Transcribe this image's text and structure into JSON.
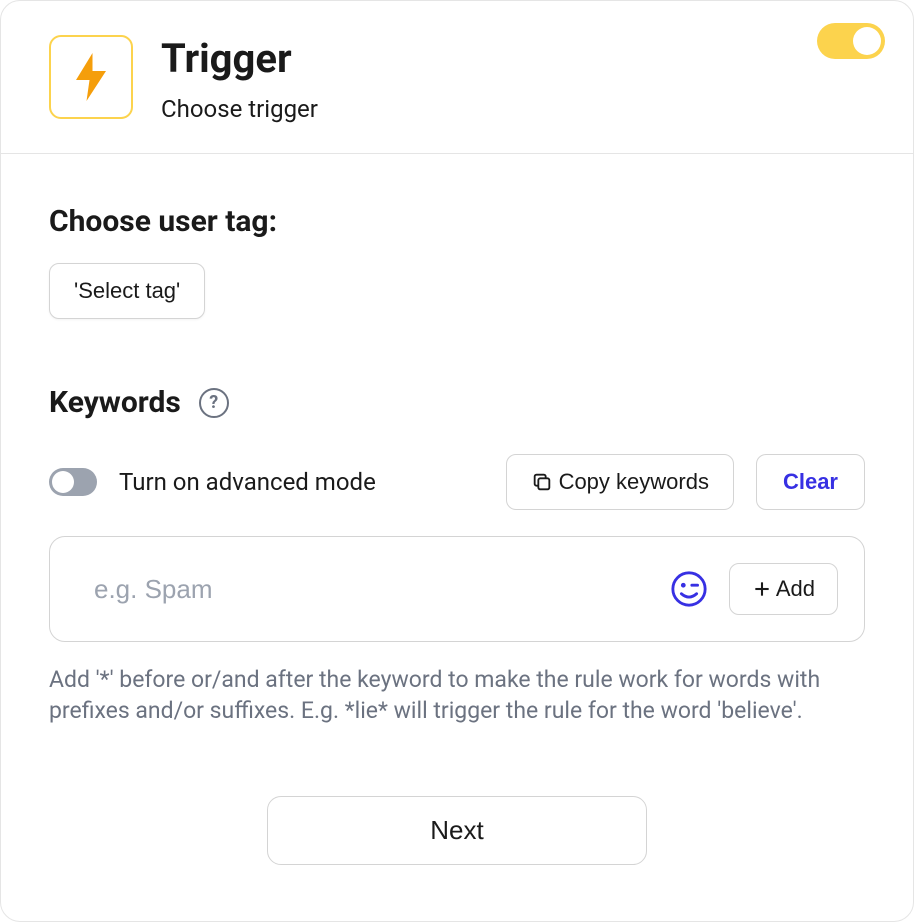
{
  "header": {
    "title": "Trigger",
    "subtitle": "Choose trigger"
  },
  "userTag": {
    "label": "Choose user tag:",
    "selectButton": "'Select tag'"
  },
  "keywords": {
    "label": "Keywords",
    "advancedModeLabel": "Turn on advanced mode",
    "copyButton": "Copy keywords",
    "clearButton": "Clear",
    "inputPlaceholder": "e.g. Spam",
    "addButton": "Add",
    "hint": "Add '*' before or/and after the keyword to make the rule work for words with prefixes and/or suffixes. E.g. *lie* will trigger the rule for the word 'believe'."
  },
  "nextButton": "Next"
}
